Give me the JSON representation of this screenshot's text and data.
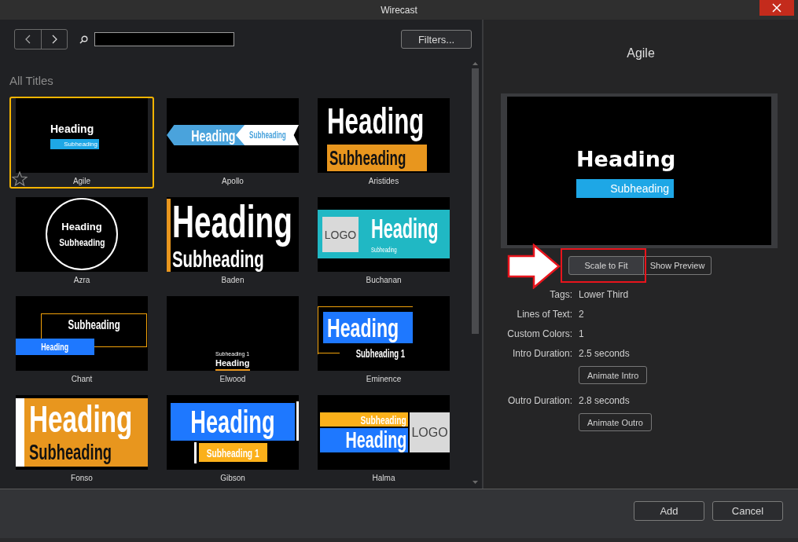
{
  "window": {
    "title": "Wirecast"
  },
  "browser": {
    "filters_label": "Filters...",
    "section_title": "All Titles"
  },
  "templates": [
    {
      "name": "Agile",
      "kind": "agile",
      "heading": "Heading",
      "subheading": "Subheading",
      "selected": true
    },
    {
      "name": "Apollo",
      "kind": "apollo",
      "heading": "Heading",
      "subheading": "Subheading",
      "selected": false
    },
    {
      "name": "Aristides",
      "kind": "aristides",
      "heading": "Heading",
      "subheading": "Subheading",
      "selected": false
    },
    {
      "name": "Azra",
      "kind": "azra",
      "heading": "Heading",
      "subheading": "Subheading",
      "selected": false
    },
    {
      "name": "Baden",
      "kind": "baden",
      "heading": "Heading",
      "subheading": "Subheading",
      "selected": false
    },
    {
      "name": "Buchanan",
      "kind": "buchanan",
      "heading": "Heading",
      "subheading": "Subheading",
      "logo": "LOGO",
      "selected": false
    },
    {
      "name": "Chant",
      "kind": "chant",
      "heading": "Heading",
      "subheading": "Subheading",
      "selected": false
    },
    {
      "name": "Elwood",
      "kind": "elwood",
      "heading": "Heading",
      "subheading": "Subheading 1",
      "selected": false
    },
    {
      "name": "Eminence",
      "kind": "eminence",
      "heading": "Heading",
      "subheading": "Subheading 1",
      "selected": false
    },
    {
      "name": "Fonso",
      "kind": "fonso",
      "heading": "Heading",
      "subheading": "Subheading",
      "selected": false
    },
    {
      "name": "Gibson",
      "kind": "gibson",
      "heading": "Heading",
      "subheading": "Subheading 1",
      "selected": false
    },
    {
      "name": "Halma",
      "kind": "halma",
      "heading": "Heading",
      "subheading": "Subheading",
      "logo": "LOGO",
      "selected": false
    }
  ],
  "details": {
    "title": "Agile",
    "preview": {
      "heading": "Heading",
      "subheading": "Subheading"
    },
    "view_buttons": [
      {
        "label": "Scale to Fit",
        "selected": true,
        "highlighted": true
      },
      {
        "label": "Show Preview",
        "selected": false,
        "highlighted": false
      }
    ],
    "fields": [
      {
        "label": "Tags:",
        "value": "Lower Third"
      },
      {
        "label": "Lines of Text:",
        "value": "2"
      },
      {
        "label": "Custom Colors:",
        "value": "1"
      },
      {
        "label": "Intro Duration:",
        "value": "2.5 seconds",
        "button": "Animate Intro"
      },
      {
        "label": "Outro Duration:",
        "value": "2.8 seconds",
        "button": "Animate Outro"
      }
    ]
  },
  "footer_buttons": [
    "Add",
    "Cancel"
  ]
}
